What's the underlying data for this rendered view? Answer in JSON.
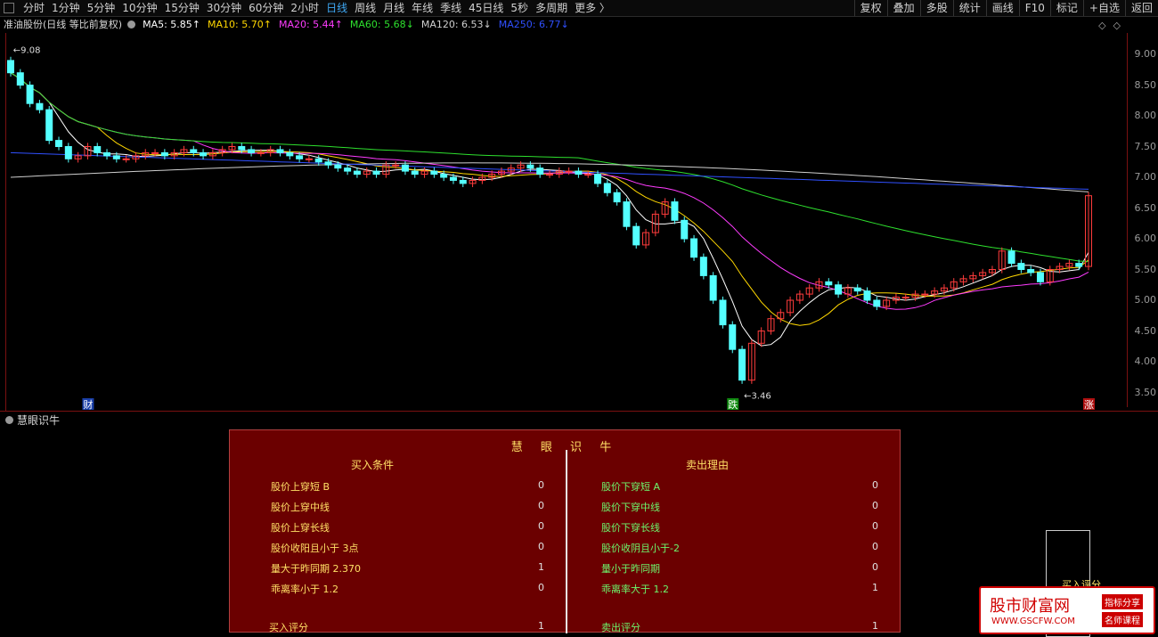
{
  "toolbar": {
    "periods": [
      "分时",
      "1分钟",
      "5分钟",
      "10分钟",
      "15分钟",
      "30分钟",
      "60分钟",
      "2小时",
      "日线",
      "周线",
      "月线",
      "年线",
      "季线",
      "45日线",
      "5秒",
      "多周期",
      "更多 〉"
    ],
    "active": "日线",
    "right": [
      "复权",
      "叠加",
      "多股",
      "统计",
      "画线",
      "F10",
      "标记",
      "+自选",
      "返回"
    ]
  },
  "title": {
    "stock": "准油股份(日线 等比前复权)",
    "ma": [
      {
        "label": "MA5: 5.85↑",
        "color": "#ffffff"
      },
      {
        "label": "MA10: 5.70↑",
        "color": "#ffd700"
      },
      {
        "label": "MA20: 5.44↑",
        "color": "#ff3cff"
      },
      {
        "label": "MA60: 5.68↓",
        "color": "#2ee02e"
      },
      {
        "label": "MA120: 6.53↓",
        "color": "#cfcfcf"
      },
      {
        "label": "MA250: 6.77↓",
        "color": "#3050ff"
      }
    ]
  },
  "price_axis": [
    "9.00",
    "8.50",
    "8.00",
    "7.50",
    "7.00",
    "6.50",
    "6.00",
    "5.50",
    "5.00",
    "4.50",
    "4.00",
    "3.50"
  ],
  "chart_data": {
    "type": "candlestick",
    "high_label": "9.08",
    "low_label": "3.46",
    "markers": [
      "财",
      "跌",
      "涨"
    ],
    "ylim": [
      3.3,
      9.2
    ],
    "closes": [
      8.7,
      8.5,
      8.2,
      8.1,
      7.6,
      7.5,
      7.3,
      7.35,
      7.5,
      7.4,
      7.35,
      7.3,
      7.3,
      7.35,
      7.4,
      7.4,
      7.35,
      7.4,
      7.45,
      7.4,
      7.35,
      7.4,
      7.45,
      7.5,
      7.45,
      7.4,
      7.4,
      7.45,
      7.4,
      7.35,
      7.3,
      7.3,
      7.25,
      7.2,
      7.15,
      7.1,
      7.05,
      7.1,
      7.05,
      7.2,
      7.2,
      7.1,
      7.05,
      7.1,
      7.05,
      7.0,
      6.95,
      6.9,
      6.95,
      7.0,
      7.05,
      7.1,
      7.15,
      7.2,
      7.15,
      7.05,
      7.05,
      7.1,
      7.1,
      7.05,
      7.05,
      6.9,
      6.75,
      6.6,
      6.2,
      5.9,
      6.1,
      6.4,
      6.6,
      6.3,
      6.0,
      5.7,
      5.4,
      5.0,
      4.6,
      4.2,
      3.7,
      4.3,
      4.5,
      4.7,
      4.8,
      5.0,
      5.1,
      5.2,
      5.3,
      5.25,
      5.1,
      5.2,
      5.15,
      5.0,
      4.9,
      5.0,
      5.05,
      5.05,
      5.1,
      5.1,
      5.15,
      5.2,
      5.3,
      5.35,
      5.4,
      5.45,
      5.5,
      5.8,
      5.6,
      5.5,
      5.45,
      5.3,
      5.5,
      5.55,
      5.6,
      5.55,
      6.7
    ]
  },
  "indicator": {
    "name": "慧眼识牛",
    "panel_title": "慧 眼 识 牛",
    "buy_head": "买入条件",
    "sell_head": "卖出理由",
    "buy_rows": [
      {
        "label": "股价上穿短 B",
        "value": "0"
      },
      {
        "label": "股价上穿中线",
        "value": "0"
      },
      {
        "label": "股价上穿长线",
        "value": "0"
      },
      {
        "label": "股价收阳且小于 3点",
        "value": "0"
      },
      {
        "label": "量大于昨同期   2.370",
        "value": "1"
      },
      {
        "label": "乖离率小于 1.2",
        "value": "0"
      }
    ],
    "sell_rows": [
      {
        "label": "股价下穿短 A",
        "value": "0"
      },
      {
        "label": "股价下穿中线",
        "value": "0"
      },
      {
        "label": "股价下穿长线",
        "value": "0"
      },
      {
        "label": "股价收阴且小于-2",
        "value": "0"
      },
      {
        "label": "量小于昨同期",
        "value": "0"
      },
      {
        "label": "乖离率大于 1.2",
        "value": "1"
      }
    ],
    "buy_score": {
      "label": "买入评分",
      "value": "1"
    },
    "sell_score": {
      "label": "卖出评分",
      "value": "1"
    },
    "side_label": "买入评分"
  },
  "watermark": {
    "main": "股市财富网",
    "url": "WWW.GSCFW.COM",
    "badge1": "指标分享",
    "badge2": "名师课程"
  }
}
